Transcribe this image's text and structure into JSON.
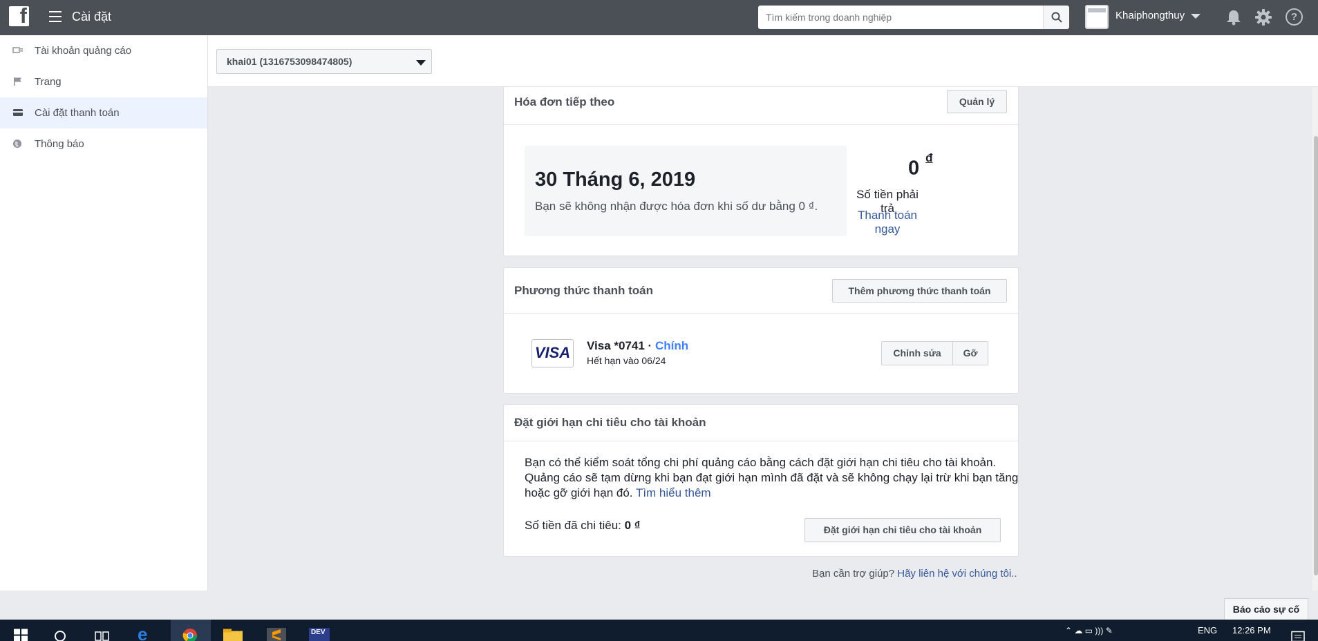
{
  "topbar": {
    "logo": "f",
    "title": "Cài đặt",
    "search_placeholder": "Tìm kiếm trong doanh nghiệp",
    "business_name": "Khaiphongthuy",
    "help_glyph": "?"
  },
  "sidebar": {
    "items": [
      {
        "label": "Tài khoản quảng cáo",
        "icon": "ad-account-icon"
      },
      {
        "label": "Trang",
        "icon": "flag-icon"
      },
      {
        "label": "Cài đặt thanh toán",
        "icon": "credit-card-icon",
        "active": true
      },
      {
        "label": "Thông báo",
        "icon": "globe-icon"
      }
    ]
  },
  "account_selector": {
    "value": "khai01 (1316753098474805)"
  },
  "next_bill": {
    "title": "Hóa đơn tiếp theo",
    "manage_label": "Quản lý",
    "date": "30 Tháng 6, 2019",
    "note": "Bạn sẽ không nhận được hóa đơn khi số dư bằng 0 ₫.",
    "amount": "0",
    "currency": "đ",
    "amount_label": "Số tiền phải trả",
    "pay_now": "Thanh toán ngay"
  },
  "payment_method": {
    "title": "Phương thức thanh toán",
    "add_label": "Thêm phương thức thanh toán",
    "card_logo": "VISA",
    "card_name": "Visa *0741 · ",
    "card_primary": "Chính",
    "card_expiry": "Hết hạn vào 06/24",
    "edit_label": "Chỉnh sửa",
    "remove_label": "Gỡ"
  },
  "spending_limit": {
    "title": "Đặt giới hạn chi tiêu cho tài khoản",
    "description": "Bạn có thể kiểm soát tổng chi phí quảng cáo bằng cách đặt giới hạn chi tiêu cho tài khoản. Quảng cáo sẽ tạm dừng khi bạn đạt giới hạn mình đã đặt và sẽ không chạy lại trừ khi bạn tăng hoặc gỡ giới hạn đó.",
    "learn_more": "Tìm hiểu thêm",
    "spent_label": "Số tiền đã chi tiêu:",
    "spent_value": "0 ₫",
    "set_limit_label": "Đặt giới hạn chi tiêu cho tài khoản"
  },
  "help": {
    "question": "Bạn cần trợ giúp?",
    "link": "Hãy liên hệ với chúng tôi.."
  },
  "report_button": "Báo cáo sự cố",
  "taskbar": {
    "language": "ENG",
    "time": "12:26 PM",
    "dev_label": "DEV"
  },
  "colors": {
    "topbar": "#4b4f56",
    "link": "#365899",
    "primary_badge": "#4080ff",
    "taskbar": "#0f1d2e"
  }
}
